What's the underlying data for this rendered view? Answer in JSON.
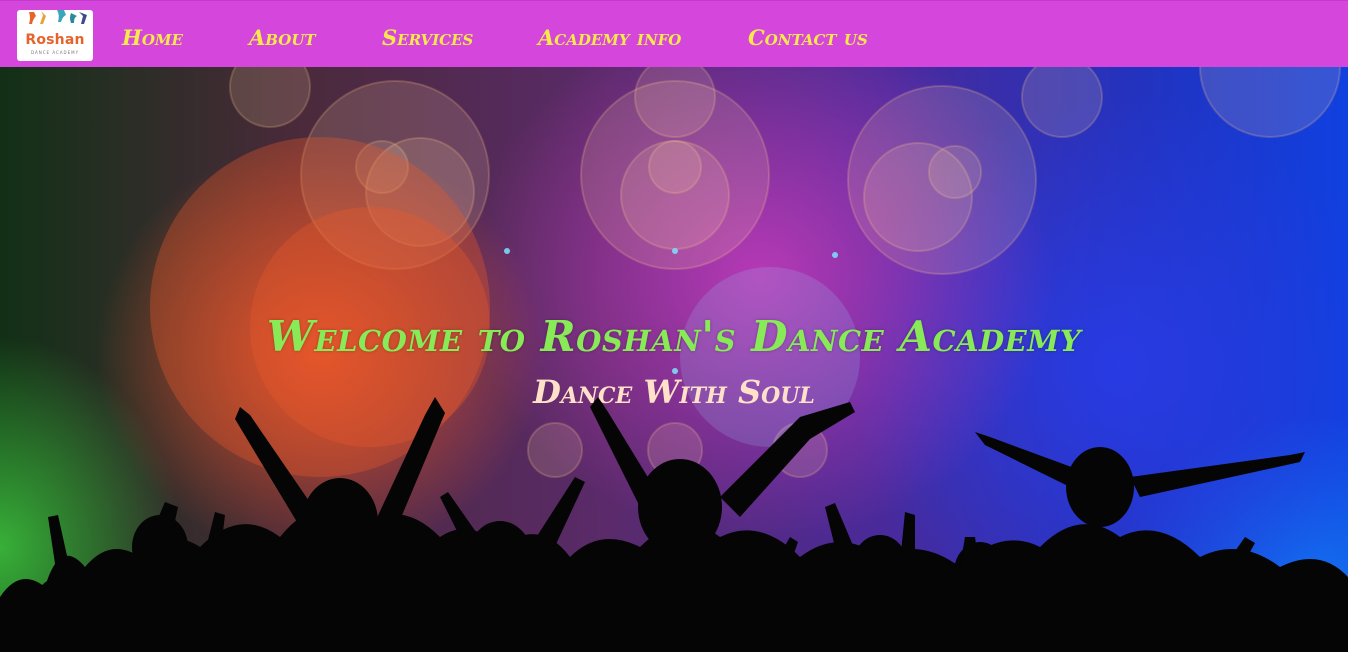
{
  "brand": {
    "logo_name": "Roshan",
    "logo_subtitle": "DANCE ACADEMY"
  },
  "nav": {
    "items": [
      {
        "label": "Home"
      },
      {
        "label": "About"
      },
      {
        "label": "Services"
      },
      {
        "label": "Academy info"
      },
      {
        "label": "Contact us"
      }
    ]
  },
  "hero": {
    "title": "Welcome to Roshan's Dance Academy",
    "tagline": "Dance With Soul"
  },
  "colors": {
    "navbar": "#d546dd",
    "nav_text": "#f7e94a",
    "hero_title": "#88ea57",
    "hero_tagline": "#ffe0c8",
    "logo_text": "#e6632b"
  }
}
